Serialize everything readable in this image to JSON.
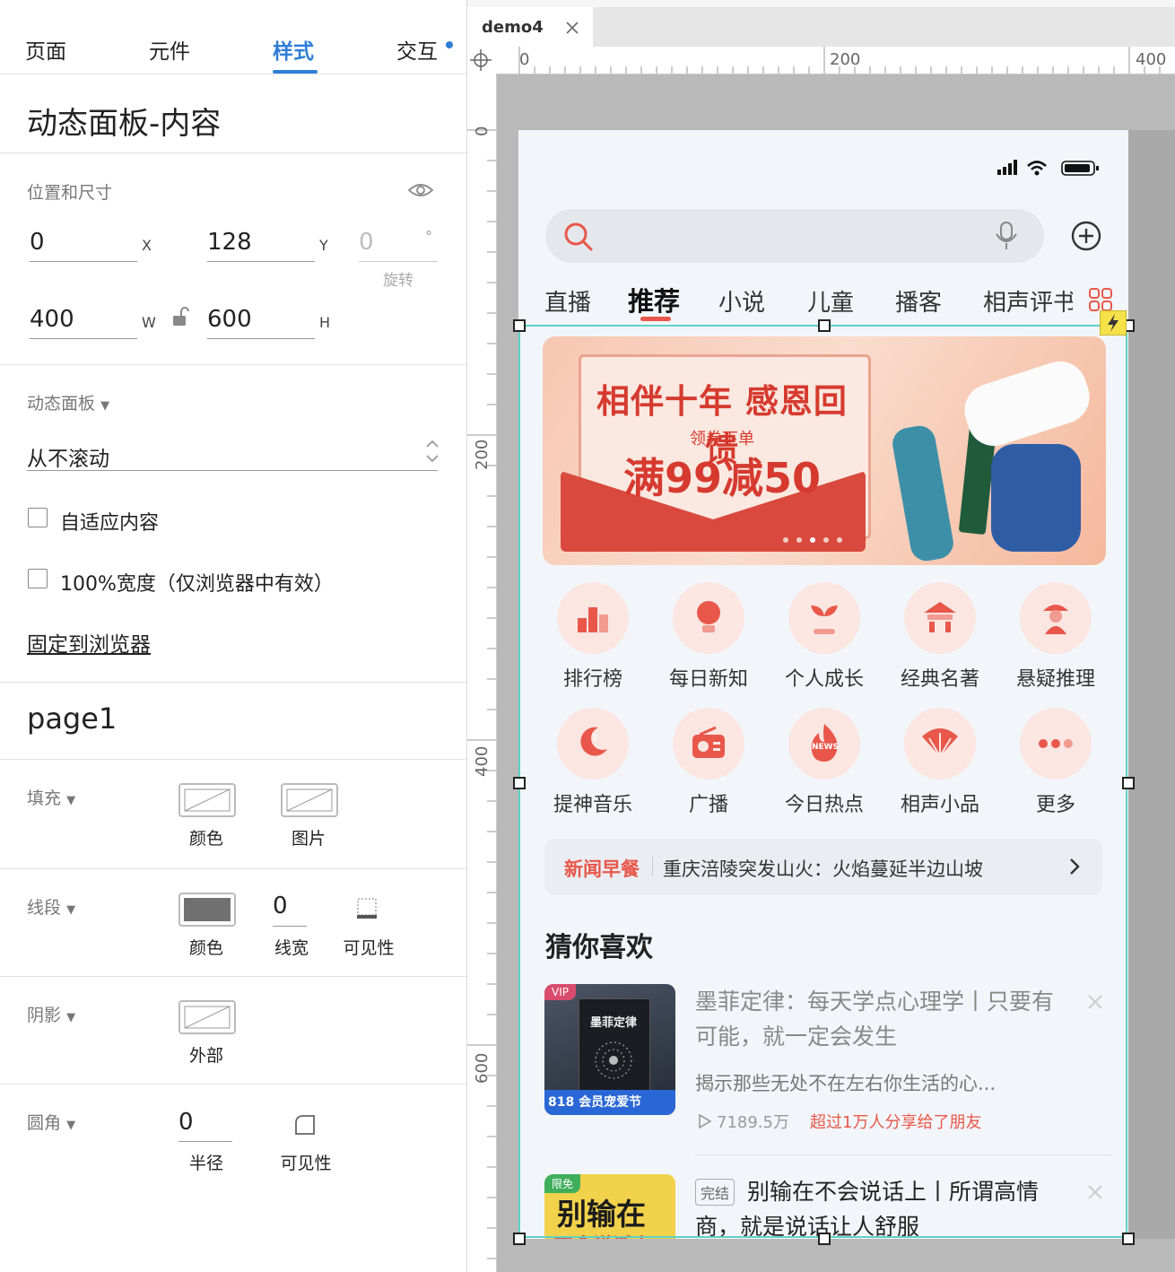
{
  "inspector": {
    "tabs": [
      {
        "label": "页面"
      },
      {
        "label": "元件"
      },
      {
        "label": "样式"
      },
      {
        "label": "交互"
      }
    ],
    "panel_title": "动态面板-内容",
    "position_section": "位置和尺寸",
    "x": "0",
    "x_unit": "X",
    "y": "128",
    "y_unit": "Y",
    "rotation": "0",
    "rotation_unit": "°",
    "rotation_label": "旋转",
    "w": "400",
    "w_unit": "W",
    "h": "600",
    "h_unit": "H",
    "dynamic_panel_label": "动态面板",
    "scroll_select": "从不滚动",
    "fit_content": "自适应内容",
    "full_width": "100%宽度（仅浏览器中有效）",
    "pin_to_browser": "固定到浏览器",
    "page_name": "page1",
    "fill_label": "填充",
    "fill_color": "颜色",
    "fill_image": "图片",
    "line_label": "线段",
    "line_color": "颜色",
    "line_width_value": "0",
    "line_width": "线宽",
    "line_visibility": "可见性",
    "shadow_label": "阴影",
    "shadow_outer": "外部",
    "radius_label": "圆角",
    "radius_value": "0",
    "radius_caption": "半径",
    "radius_visibility": "可见性"
  },
  "canvas": {
    "doc_tab": "demo4",
    "ruler_h": [
      "0",
      "200",
      "400"
    ],
    "ruler_v": [
      "0",
      "200",
      "400",
      "600"
    ]
  },
  "app": {
    "categories": [
      "直播",
      "推荐",
      "小说",
      "儿童",
      "播客",
      "相声评书"
    ],
    "banner": {
      "title": "相伴十年 感恩回馈",
      "sub": "领券下单",
      "offer": "满99减50"
    },
    "grid": [
      {
        "label": "排行榜",
        "icon": "trophy-icon"
      },
      {
        "label": "每日新知",
        "icon": "bulb-icon"
      },
      {
        "label": "个人成长",
        "icon": "sprout-icon"
      },
      {
        "label": "经典名著",
        "icon": "temple-icon"
      },
      {
        "label": "悬疑推理",
        "icon": "detective-icon"
      },
      {
        "label": "提神音乐",
        "icon": "moon-icon"
      },
      {
        "label": "广播",
        "icon": "radio-icon"
      },
      {
        "label": "今日热点",
        "icon": "news-icon"
      },
      {
        "label": "相声小品",
        "icon": "fan-icon"
      },
      {
        "label": "更多",
        "icon": "more-icon"
      }
    ],
    "news_icon_text": "NEWS",
    "news": {
      "tag": "新闻早餐",
      "text": "重庆涪陵突发山火：火焰蔓延半边山坡"
    },
    "section_title": "猜你喜欢",
    "items": [
      {
        "badge": "VIP",
        "cover_title": "墨菲定律",
        "cover_promo": "818 会员宠爱节",
        "title": "墨菲定律：每天学点心理学丨只要有可能，就一定会发生",
        "desc": "揭示那些无处不在左右你生活的心...",
        "plays": "7189.5万",
        "share": "超过1万人分享给了朋友"
      },
      {
        "badge": "限免",
        "cover_title": "别输在",
        "cover_sub": "不会说话上",
        "status": "完结",
        "title": "别输在不会说话上丨所谓高情商，就是说话让人舒服"
      }
    ],
    "colors": {
      "accent": "#e8574a",
      "select": "#5fd1c6",
      "tab_accent": "#2f7fd6"
    }
  }
}
